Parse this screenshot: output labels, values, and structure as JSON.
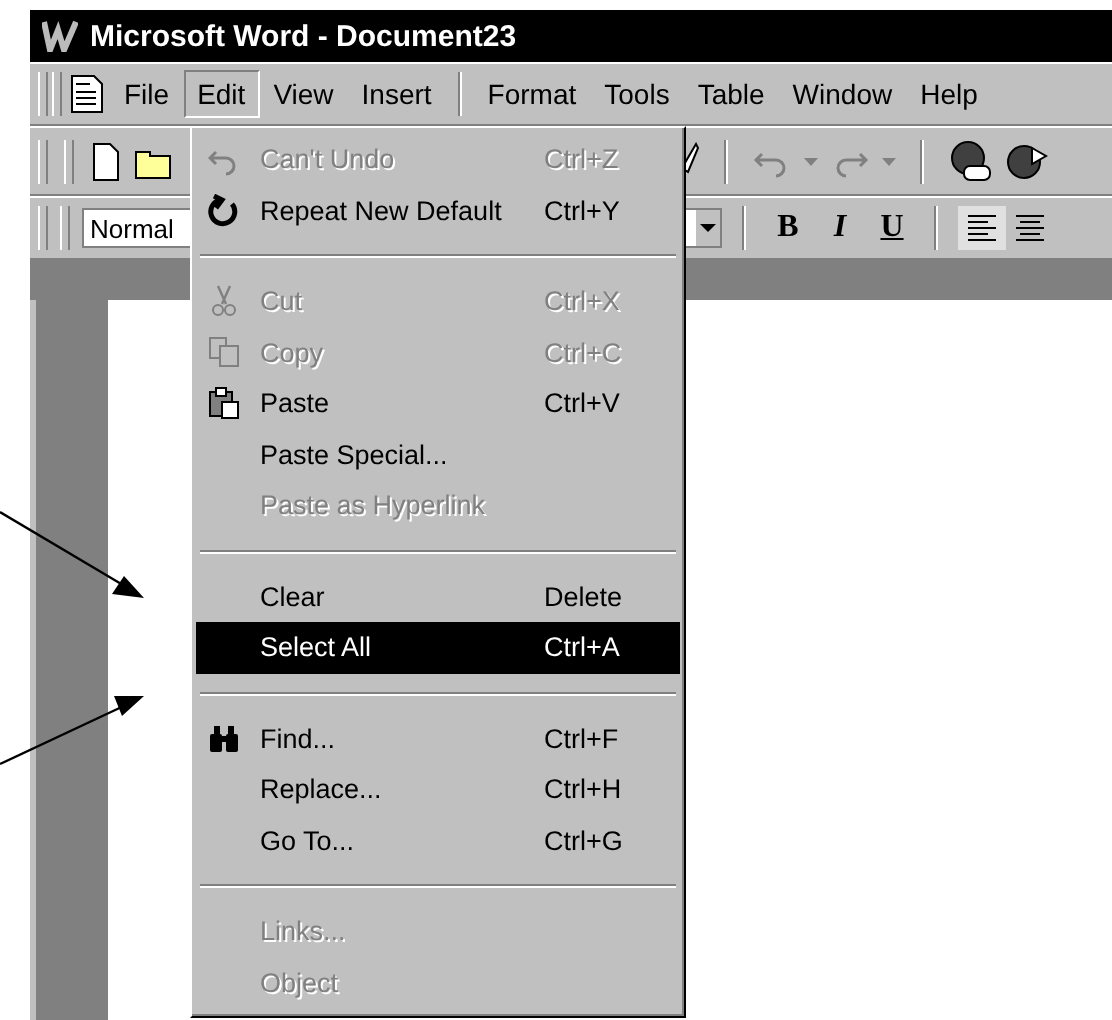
{
  "window": {
    "title": "Microsoft Word - Document23"
  },
  "menu_bar": [
    {
      "label": "File",
      "selected": false
    },
    {
      "label": "Edit",
      "selected": true
    },
    {
      "label": "View",
      "selected": false
    },
    {
      "label": "Insert",
      "selected": false
    },
    {
      "label": "Format",
      "selected": false
    },
    {
      "label": "Tools",
      "selected": false
    },
    {
      "label": "Table",
      "selected": false
    },
    {
      "label": "Window",
      "selected": false
    },
    {
      "label": "Help",
      "selected": false
    }
  ],
  "formatting_toolbar": {
    "style": "Normal",
    "buttons": [
      "B",
      "I",
      "U"
    ]
  },
  "edit_menu": [
    {
      "kind": "item",
      "label": "Can't Undo",
      "shortcut": "Ctrl+Z",
      "disabled": true,
      "selected": false
    },
    {
      "kind": "item",
      "label": "Repeat New Default",
      "shortcut": "Ctrl+Y",
      "disabled": false,
      "selected": false
    },
    {
      "kind": "separator"
    },
    {
      "kind": "item",
      "label": "Cut",
      "shortcut": "Ctrl+X",
      "disabled": true,
      "selected": false
    },
    {
      "kind": "item",
      "label": "Copy",
      "shortcut": "Ctrl+C",
      "disabled": true,
      "selected": false
    },
    {
      "kind": "item",
      "label": "Paste",
      "shortcut": "Ctrl+V",
      "disabled": false,
      "selected": false
    },
    {
      "kind": "item",
      "label": "Paste Special...",
      "disabled": false,
      "selected": false
    },
    {
      "kind": "item",
      "label": "Paste as Hyperlink",
      "disabled": true,
      "selected": false
    },
    {
      "kind": "separator"
    },
    {
      "kind": "item",
      "label": "Clear",
      "shortcut": "Delete",
      "disabled": false,
      "selected": false
    },
    {
      "kind": "item",
      "label": "Select All",
      "shortcut": "Ctrl+A",
      "disabled": false,
      "selected": true
    },
    {
      "kind": "separator"
    },
    {
      "kind": "item",
      "label": "Find...",
      "shortcut": "Ctrl+F",
      "disabled": false,
      "selected": false
    },
    {
      "kind": "item",
      "label": "Replace...",
      "shortcut": "Ctrl+H",
      "disabled": false,
      "selected": false
    },
    {
      "kind": "item",
      "label": "Go To...",
      "shortcut": "Ctrl+G",
      "disabled": false,
      "selected": false
    },
    {
      "kind": "separator"
    },
    {
      "kind": "item",
      "label": "Links...",
      "disabled": true,
      "selected": false
    },
    {
      "kind": "item",
      "label": "Object",
      "disabled": true,
      "selected": false
    }
  ]
}
